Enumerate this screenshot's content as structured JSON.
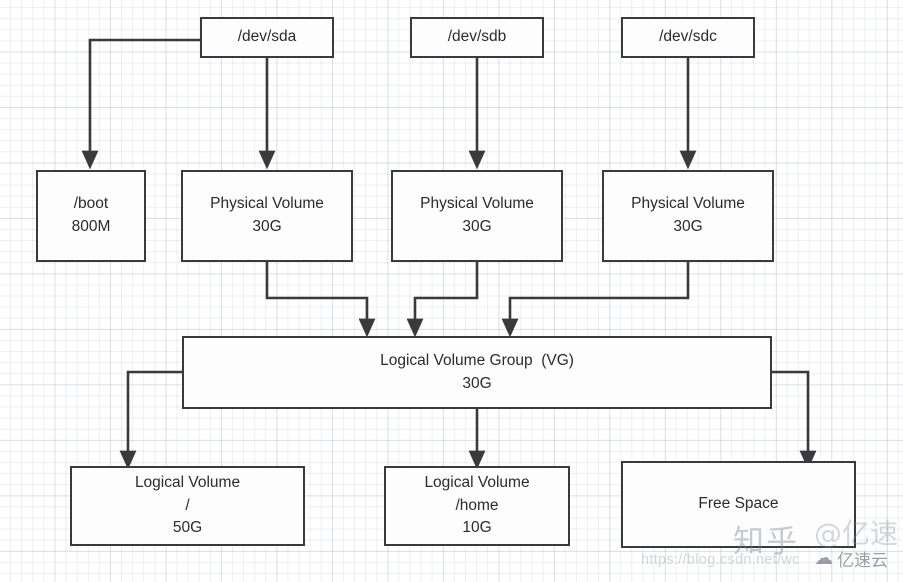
{
  "diagram": {
    "title": "LVM disk layout diagram",
    "background": {
      "color": "#ffffff",
      "grid_minor_color": "#969eb2",
      "grid_major_color": "#b4b9c8"
    },
    "style": {
      "node_border_color": "#3a3a3c",
      "node_fill_color": "#fdfdfd",
      "edge_color": "#3a3a3c",
      "text_color": "#2b2b2d"
    },
    "nodes": [
      {
        "id": "sda",
        "lines": [
          "/dev/sda"
        ]
      },
      {
        "id": "sdb",
        "lines": [
          "/dev/sdb"
        ]
      },
      {
        "id": "sdc",
        "lines": [
          "/dev/sdc"
        ]
      },
      {
        "id": "boot",
        "lines": [
          "/boot",
          "800M"
        ]
      },
      {
        "id": "pv1",
        "lines": [
          "Physical Volume",
          "30G"
        ]
      },
      {
        "id": "pv2",
        "lines": [
          "Physical Volume",
          "30G"
        ]
      },
      {
        "id": "pv3",
        "lines": [
          "Physical Volume",
          "30G"
        ]
      },
      {
        "id": "vg",
        "lines": [
          "Logical Volume Group  (VG)",
          "30G"
        ]
      },
      {
        "id": "lv1",
        "lines": [
          "Logical Volume",
          "/",
          "50G"
        ]
      },
      {
        "id": "lv2",
        "lines": [
          "Logical Volume",
          "/home",
          "10G"
        ]
      },
      {
        "id": "free",
        "lines": [
          "Free Space"
        ]
      }
    ],
    "edges": [
      {
        "from": "sda",
        "to": "boot"
      },
      {
        "from": "sda",
        "to": "pv1"
      },
      {
        "from": "sdb",
        "to": "pv2"
      },
      {
        "from": "sdc",
        "to": "pv3"
      },
      {
        "from": "pv1",
        "to": "vg"
      },
      {
        "from": "pv2",
        "to": "vg"
      },
      {
        "from": "pv3",
        "to": "vg"
      },
      {
        "from": "vg",
        "to": "lv1"
      },
      {
        "from": "vg",
        "to": "lv2"
      },
      {
        "from": "vg",
        "to": "free"
      }
    ]
  },
  "watermarks": {
    "zhihu": "知乎",
    "yisuyun": "亿速云",
    "yisuyun_faint": "@亿速",
    "url": "https://blog.csdn.net/wc"
  }
}
